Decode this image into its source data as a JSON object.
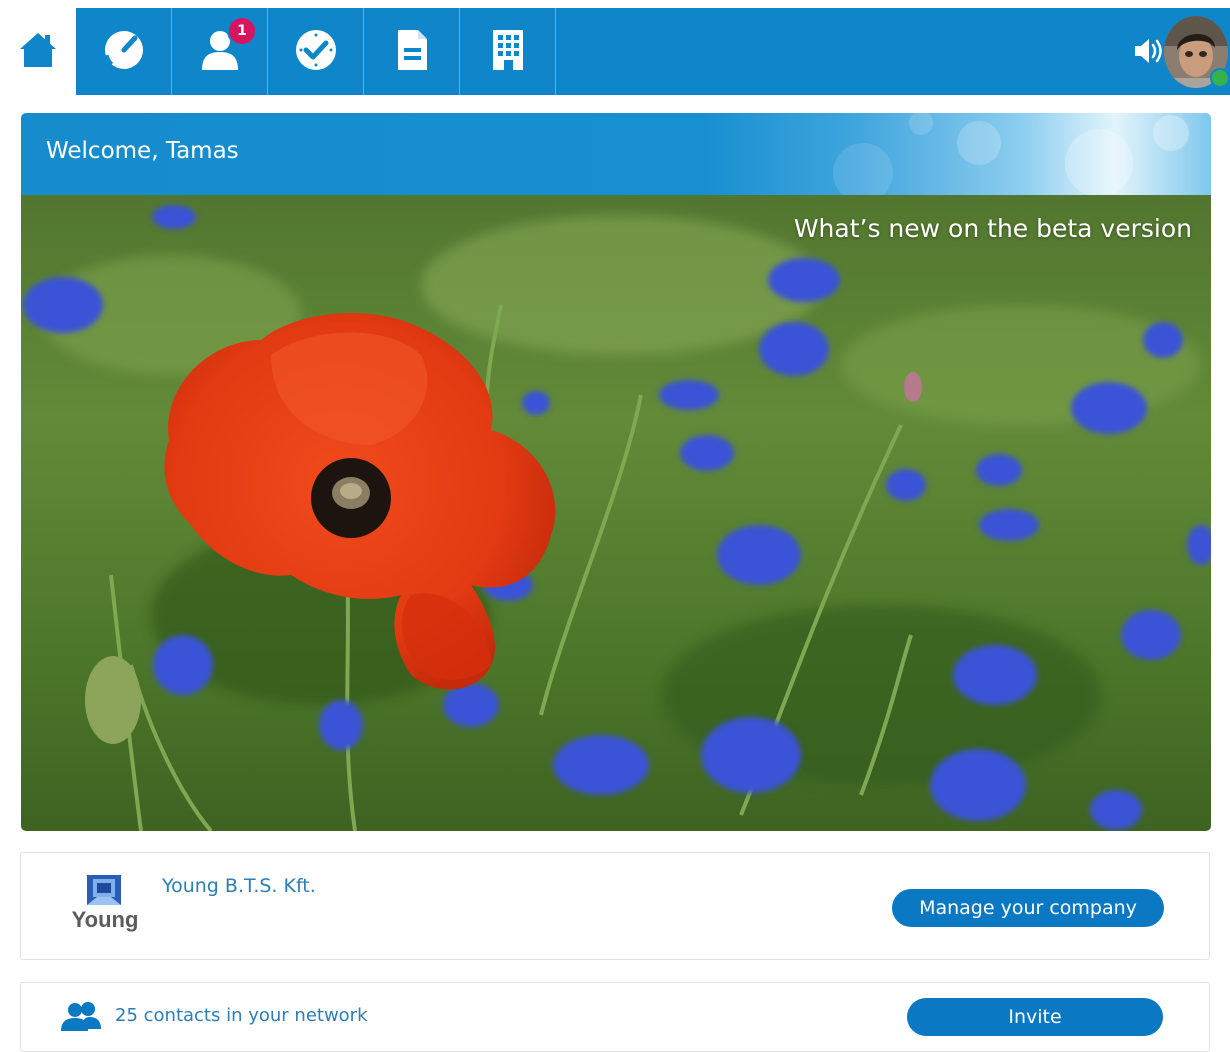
{
  "nav": {
    "badge_count": "1",
    "tabs": [
      "home",
      "dashboard",
      "contacts",
      "tasks",
      "documents",
      "company"
    ]
  },
  "hero": {
    "welcome": "Welcome, Tamas",
    "whats_new": "What’s new on the beta version"
  },
  "company": {
    "logo_text": "Young",
    "name": "Young B.T.S. Kft.",
    "manage_label": "Manage your company"
  },
  "network": {
    "contacts_text": "25 contacts in your network",
    "invite_label": "Invite"
  },
  "colors": {
    "nav_blue": "#0e86c9",
    "button_blue": "#0a78c2",
    "badge_pink": "#d6145f",
    "online_green": "#35b24a"
  }
}
